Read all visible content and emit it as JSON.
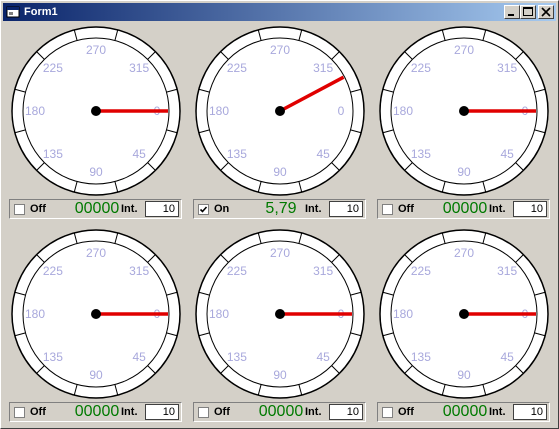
{
  "window": {
    "title": "Form1"
  },
  "gauge_labels": [
    "270",
    "315",
    "0",
    "45",
    "90",
    "135",
    "180",
    "225"
  ],
  "colors": {
    "needle": "#e00000",
    "tick_label": "#a8a8dc",
    "counter": "#007a00"
  },
  "gauges": [
    {
      "needle_deg": 0,
      "checked": false,
      "state_label": "Off",
      "counter": "00000",
      "int_label": "Int.",
      "int_value": "10"
    },
    {
      "needle_deg": 332,
      "checked": true,
      "state_label": "On",
      "counter": "5,79",
      "int_label": "Int.",
      "int_value": "10"
    },
    {
      "needle_deg": 0,
      "checked": false,
      "state_label": "Off",
      "counter": "00000",
      "int_label": "Int.",
      "int_value": "10"
    },
    {
      "needle_deg": 0,
      "checked": false,
      "state_label": "Off",
      "counter": "00000",
      "int_label": "Int.",
      "int_value": "10"
    },
    {
      "needle_deg": 0,
      "checked": false,
      "state_label": "Off",
      "counter": "00000",
      "int_label": "Int.",
      "int_value": "10"
    },
    {
      "needle_deg": 0,
      "checked": false,
      "state_label": "Off",
      "counter": "00000",
      "int_label": "Int.",
      "int_value": "10"
    }
  ]
}
